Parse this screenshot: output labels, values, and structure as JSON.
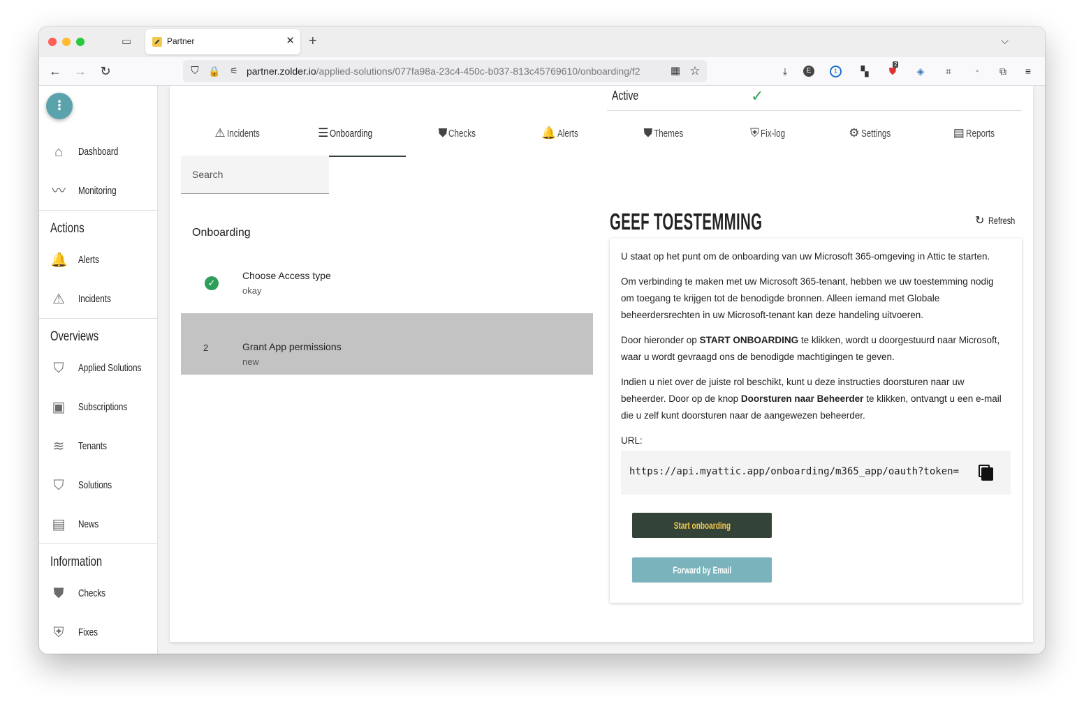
{
  "browser": {
    "tab_title": "Partner",
    "url_domain": "partner.zolder.io",
    "url_path": "/applied-solutions/077fa98a-23c4-450c-b037-813c45769610/onboarding/f2",
    "ext_badge": "2"
  },
  "sidebar": {
    "items_top": [
      {
        "label": "Dashboard",
        "icon": "home-icon"
      },
      {
        "label": "Monitoring",
        "icon": "pulse-icon"
      }
    ],
    "actions_heading": "Actions",
    "actions": [
      {
        "label": "Alerts",
        "icon": "bell-icon"
      },
      {
        "label": "Incidents",
        "icon": "warning-icon"
      }
    ],
    "overviews_heading": "Overviews",
    "overviews": [
      {
        "label": "Applied Solutions",
        "icon": "shield-pulse-icon"
      },
      {
        "label": "Subscriptions",
        "icon": "money-icon"
      },
      {
        "label": "Tenants",
        "icon": "layers-icon"
      },
      {
        "label": "Solutions",
        "icon": "shield-icon"
      },
      {
        "label": "News",
        "icon": "newspaper-icon"
      }
    ],
    "information_heading": "Information",
    "information": [
      {
        "label": "Checks",
        "icon": "shield-check-icon"
      },
      {
        "label": "Fixes",
        "icon": "shield-plus-icon"
      }
    ]
  },
  "status": {
    "label": "Active",
    "value": "✓"
  },
  "tabs": [
    {
      "label": "Incidents",
      "icon": "warning-icon",
      "glyph": "⚠"
    },
    {
      "label": "Onboarding",
      "icon": "list-icon",
      "glyph": "☰",
      "selected": true
    },
    {
      "label": "Checks",
      "icon": "shield-check-icon",
      "glyph": "⛊"
    },
    {
      "label": "Alerts",
      "icon": "bell-icon",
      "glyph": "🔔"
    },
    {
      "label": "Themes",
      "icon": "shield-themes-icon",
      "glyph": "⛊"
    },
    {
      "label": "Fix-log",
      "icon": "shield-plus-icon",
      "glyph": "⛨"
    },
    {
      "label": "Settings",
      "icon": "gear-icon",
      "glyph": "⚙"
    },
    {
      "label": "Reports",
      "icon": "document-icon",
      "glyph": "▤"
    }
  ],
  "search": {
    "placeholder": "Search",
    "value": ""
  },
  "onboarding": {
    "title": "Onboarding",
    "steps": [
      {
        "title": "Choose Access type",
        "status": "okay",
        "done": true
      },
      {
        "number": "2",
        "title": "Grant App permissions",
        "status": "new",
        "done": false
      }
    ]
  },
  "consent": {
    "title": "GEEF TOESTEMMING",
    "refresh_label": "Refresh",
    "p1": "U staat op het punt om de onboarding van uw Microsoft 365-omgeving in Attic te starten.",
    "p2": "Om verbinding te maken met uw Microsoft 365-tenant, hebben we uw toestemming nodig om toegang te krijgen tot de benodigde bronnen. Alleen iemand met Globale beheerdersrechten in uw Microsoft-tenant kan deze handeling uitvoeren.",
    "p3_before": "Door hieronder op ",
    "p3_bold": "START ONBOARDING",
    "p3_after": " te klikken, wordt u doorgestuurd naar Microsoft, waar u wordt gevraagd ons de benodigde machtigingen te geven.",
    "p4_before": "Indien u niet over de juiste rol beschikt, kunt u deze instructies doorsturen naar uw beheerder. Door op de knop ",
    "p4_bold": "Doorsturen naar Beheerder",
    "p4_after": " te klikken, ontvangt u een e-mail die u zelf kunt doorsturen naar de aangewezen beheerder.",
    "url_label": "URL:",
    "url_value": "https://api.myattic.app/onboarding/m365_app/oauth?token=",
    "start_button": "Start onboarding",
    "forward_button": "Forward by Email"
  },
  "colors": {
    "brand_dark": "#344338",
    "brand_yellow": "#f2c94c",
    "accent_teal": "#7ab3bb",
    "fab_teal": "#5ba3ac",
    "success_green": "#2f9e58",
    "current_step_bg": "#c3c3c3"
  }
}
